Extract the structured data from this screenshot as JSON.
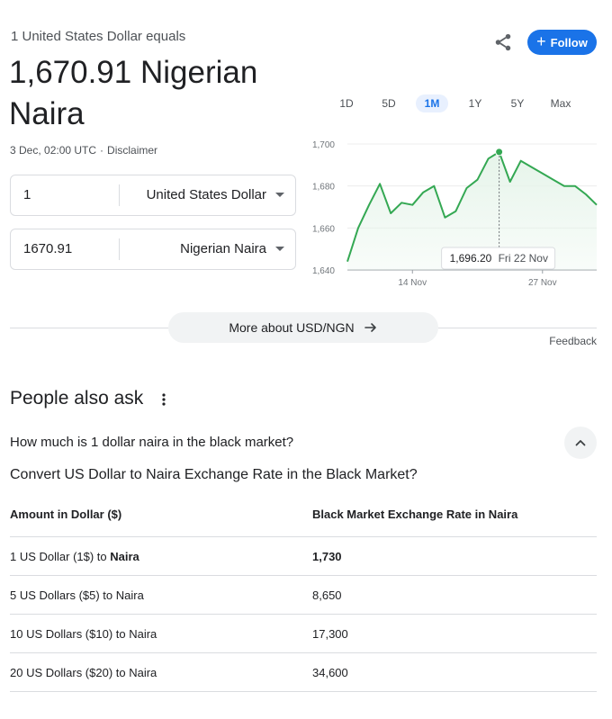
{
  "header": {
    "equals_label": "1 United States Dollar equals",
    "rate_display": "1,670.91 Nigerian Naira",
    "timestamp": "3 Dec, 02:00 UTC",
    "separator": "·",
    "disclaimer": "Disclaimer",
    "follow_label": "Follow"
  },
  "converter": {
    "from": {
      "amount": "1",
      "currency": "United States Dollar"
    },
    "to": {
      "amount": "1670.91",
      "currency": "Nigerian Naira"
    }
  },
  "chart": {
    "ranges": [
      "1D",
      "5D",
      "1M",
      "1Y",
      "5Y",
      "Max"
    ],
    "active_range": "1M"
  },
  "chart_data": {
    "type": "area",
    "ylim": [
      1640,
      1700
    ],
    "y_ticks": [
      "1,700",
      "1,680",
      "1,660",
      "1,640"
    ],
    "x_ticks": [
      "14 Nov",
      "27 Nov"
    ],
    "values": [
      1644,
      1660,
      1671,
      1681,
      1667,
      1672,
      1671,
      1677,
      1680,
      1665,
      1668,
      1679,
      1683,
      1693,
      1696.2,
      1682,
      1692,
      1689,
      1686,
      1683,
      1680,
      1680,
      1676,
      1671
    ],
    "line_color": "#34a853",
    "fill_color": "#e6f4ea",
    "tooltip": {
      "index": 14,
      "value": "1,696.20",
      "date": "Fri 22 Nov"
    }
  },
  "more_about": {
    "label": "More about USD/NGN"
  },
  "feedback": "Feedback",
  "people_also_ask": {
    "title": "People also ask",
    "question": "How much is 1 dollar naira in the black market?",
    "answer_heading": "Convert US Dollar to Naira Exchange Rate in the Black Market?",
    "table": {
      "headers": [
        "Amount in Dollar ($)",
        "Black Market Exchange Rate in Naira"
      ],
      "rows": [
        {
          "prefix": "1 US Dollar (1$) to ",
          "suffix_bold": "Naira",
          "rate": "1,730",
          "bold_rate": true
        },
        {
          "prefix": "5 US Dollars ($5) to Naira",
          "suffix_bold": "",
          "rate": "8,650",
          "bold_rate": false
        },
        {
          "prefix": "10 US Dollars ($10) to Naira",
          "suffix_bold": "",
          "rate": "17,300",
          "bold_rate": false
        },
        {
          "prefix": "20 US Dollars ($20) to Naira",
          "suffix_bold": "",
          "rate": "34,600",
          "bold_rate": false
        }
      ]
    }
  }
}
